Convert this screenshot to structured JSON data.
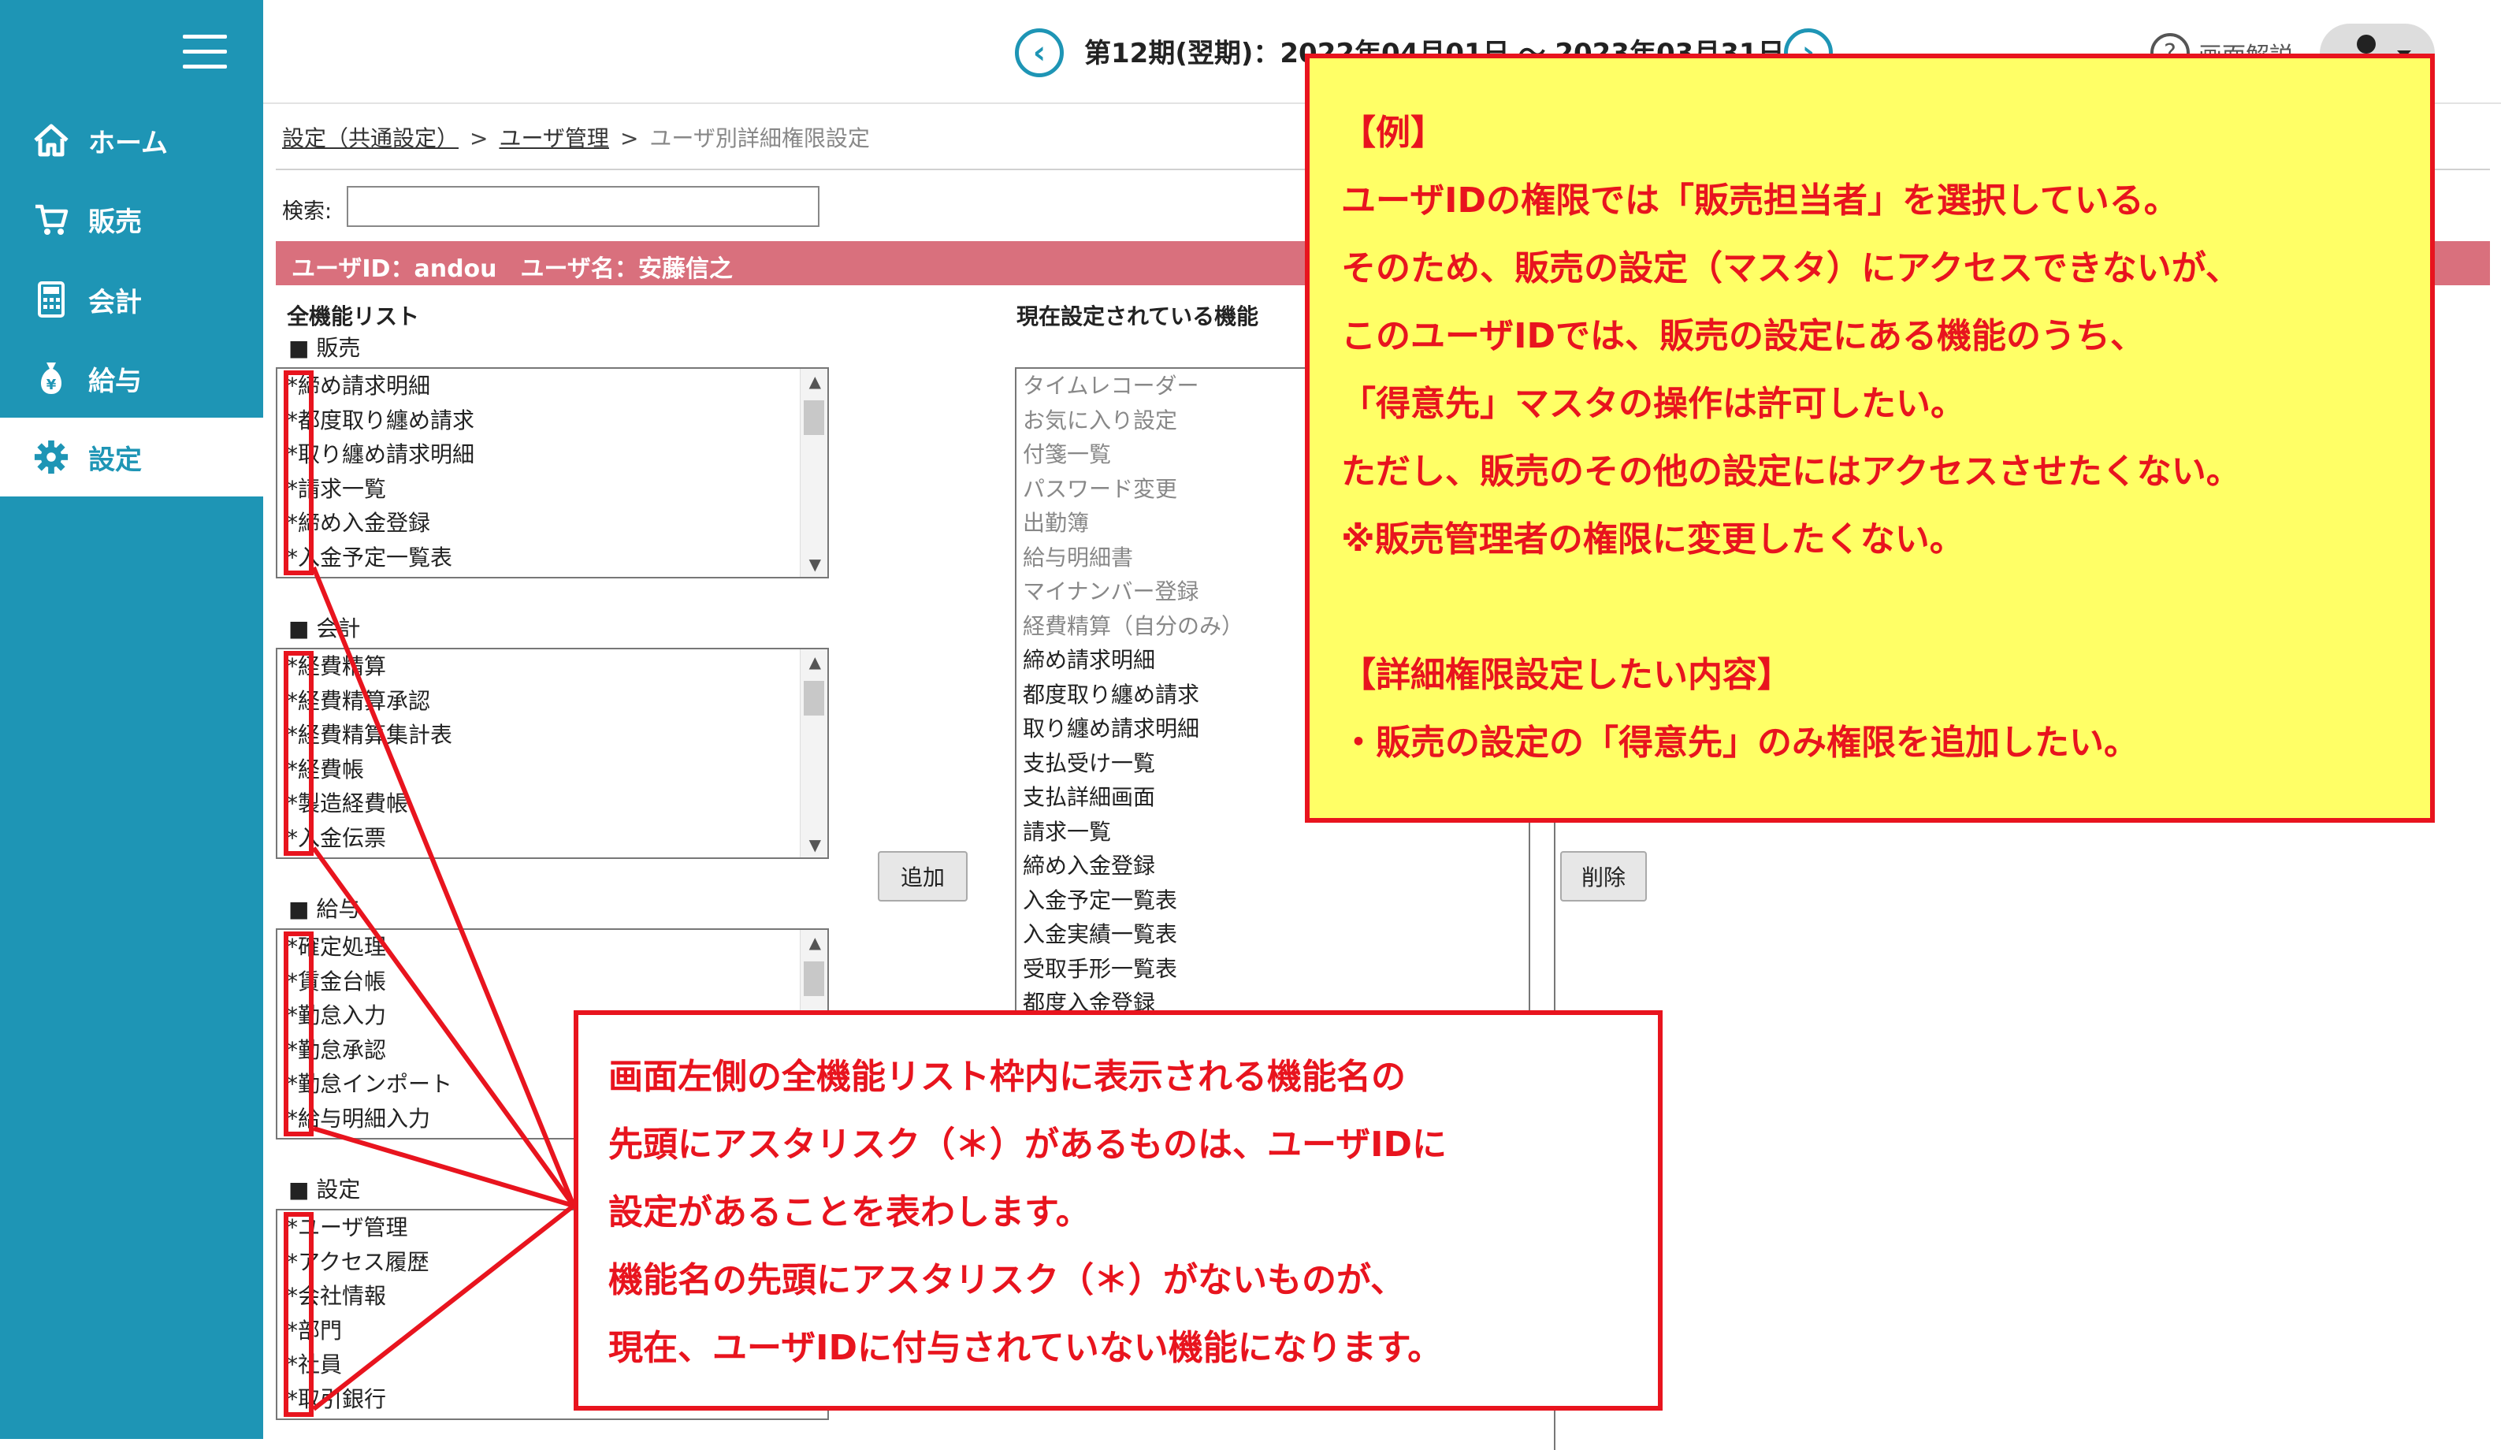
{
  "sidebar": {
    "items": [
      {
        "label": "ホーム",
        "icon": "home-icon"
      },
      {
        "label": "販売",
        "icon": "cart-icon"
      },
      {
        "label": "会計",
        "icon": "calculator-icon"
      },
      {
        "label": "給与",
        "icon": "money-bag-icon"
      },
      {
        "label": "設定",
        "icon": "gear-icon"
      }
    ],
    "active": "設定",
    "color": "#1e95b5"
  },
  "header": {
    "period": "第12期(翌期)：2022年04月01日 ～ 2023年03月31日",
    "help_label": "画面解説"
  },
  "breadcrumb": {
    "items": [
      "設定（共通設定）",
      "ユーザ管理"
    ],
    "separator": ">",
    "current": "ユーザ別詳細権限設定"
  },
  "search": {
    "label": "検索:",
    "value": ""
  },
  "user_bar": {
    "text": "ユーザID：andou　ユーザ名：安藤信之",
    "color": "#d9707d"
  },
  "all_functions": {
    "title": "全機能リスト",
    "categories": [
      {
        "name": "■ 販売",
        "items": [
          "*締め請求明細",
          "*都度取り纏め請求",
          "*取り纏め請求明細",
          "*請求一覧",
          "*締め入金登録",
          "*入金予定一覧表"
        ]
      },
      {
        "name": "■ 会計",
        "items": [
          "*経費精算",
          "*経費精算承認",
          "*経費精算集計表",
          "*経費帳",
          "*製造経費帳",
          "*入金伝票"
        ]
      },
      {
        "name": "■ 給与",
        "items": [
          "*確定処理",
          "*賃金台帳",
          "*勤怠入力",
          "*勤怠承認",
          "*勤怠インポート",
          "*給与明細入力"
        ]
      },
      {
        "name": "■ 設定",
        "items": [
          "*ユーザ管理",
          "*アクセス履歴",
          "*会社情報",
          "*部門",
          "*社員",
          "*取引銀行"
        ]
      }
    ]
  },
  "current_functions": {
    "title": "現在設定されている機能",
    "items": [
      {
        "label": "タイムレコーダー",
        "inherited": true
      },
      {
        "label": "お気に入り設定",
        "inherited": true
      },
      {
        "label": "付箋一覧",
        "inherited": true
      },
      {
        "label": "パスワード変更",
        "inherited": true
      },
      {
        "label": "出勤簿",
        "inherited": true
      },
      {
        "label": "給与明細書",
        "inherited": true
      },
      {
        "label": "マイナンバー登録",
        "inherited": true
      },
      {
        "label": "経費精算（自分のみ）",
        "inherited": true
      },
      {
        "label": "締め請求明細",
        "inherited": false
      },
      {
        "label": "都度取り纏め請求",
        "inherited": false
      },
      {
        "label": "取り纏め請求明細",
        "inherited": false
      },
      {
        "label": "支払受け一覧",
        "inherited": false
      },
      {
        "label": "支払詳細画面",
        "inherited": false
      },
      {
        "label": "請求一覧",
        "inherited": false
      },
      {
        "label": "締め入金登録",
        "inherited": false
      },
      {
        "label": "入金予定一覧表",
        "inherited": false
      },
      {
        "label": "入金実績一覧表",
        "inherited": false
      },
      {
        "label": "受取手形一覧表",
        "inherited": false
      },
      {
        "label": "都度入金登録",
        "inherited": false
      }
    ]
  },
  "buttons": {
    "add": "追加",
    "delete": "削除"
  },
  "callout_example": {
    "lines": [
      "【例】",
      "ユーザIDの権限では「販売担当者」を選択している。",
      "そのため、販売の設定（マスタ）にアクセスできないが、",
      "このユーザIDでは、販売の設定にある機能のうち、",
      "「得意先」マスタの操作は許可したい。",
      "ただし、販売のその他の設定にはアクセスさせたくない。",
      "※販売管理者の権限に変更したくない。",
      "",
      "【詳細権限設定したい内容】",
      "・販売の設定の「得意先」のみ権限を追加したい。"
    ],
    "background": "#ffff66",
    "text_color": "#e8141e"
  },
  "callout_asterisk": {
    "lines": [
      "画面左側の全機能リスト枠内に表示される機能名の",
      "先頭にアスタリスク（＊）があるものは、ユーザIDに",
      "設定があることを表わします。",
      "機能名の先頭にアスタリスク（＊）がないものが、",
      "現在、ユーザIDに付与されていない機能になります。"
    ],
    "text_color": "#e8141e"
  }
}
